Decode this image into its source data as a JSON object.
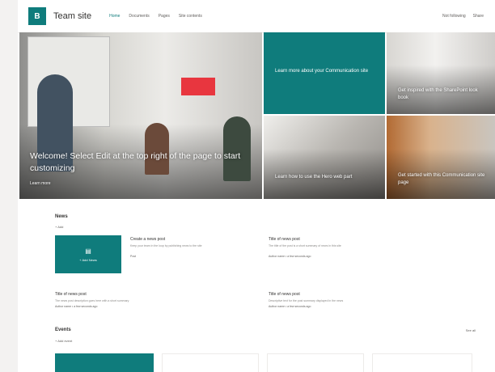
{
  "header": {
    "site_logo_text": "B",
    "site_title": "Team site",
    "nav": [
      "Home",
      "Documents",
      "Pages",
      "Site contents"
    ],
    "right": [
      "Not following",
      "Share"
    ]
  },
  "hero": {
    "main_title": "Welcome! Select Edit at the top right of the page to start customizing",
    "main_link": "Learn more",
    "teal_text": "Learn more about your Communication site",
    "people_text": "Get inspired with the SharePoint look book",
    "arch_text": "Learn how to use the Hero web part",
    "office_text": "Get started with this Communication site page"
  },
  "news": {
    "title": "News",
    "add": "+ Add",
    "feature_icon": "▤",
    "feature_label": "+ Add News",
    "items": [
      {
        "title": "Create a news post",
        "desc": "Keep your team in the loop by publishing news to the site",
        "meta": "Post"
      },
      {
        "title": "Title of news post",
        "desc": "The title of the post is a short summary of news in this site",
        "meta": "Author name  • a few seconds ago"
      },
      {
        "title": "Title of news post",
        "desc": "The news post description goes here with a short summary",
        "meta": "Author name  • a few seconds ago"
      },
      {
        "title": "Title of news post",
        "desc": "Descriptive text for the post summary displayed in the news",
        "meta": "Author name  • a few seconds ago"
      }
    ]
  },
  "events": {
    "title": "Events",
    "add": "+ Add event",
    "see_all": "See all"
  },
  "colors": {
    "accent": "#0f7c7c",
    "hero_red": "#e8363f"
  }
}
